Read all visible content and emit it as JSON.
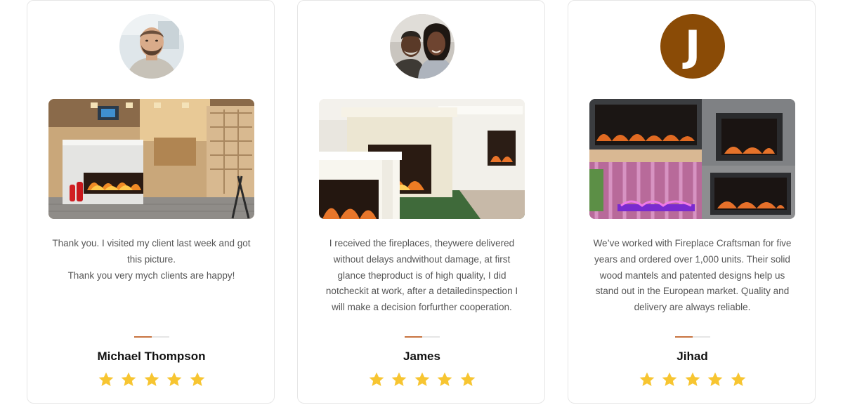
{
  "star_color": "#f7c531",
  "accent_color": "#c8733f",
  "testimonials": [
    {
      "avatar_icon": "man-portrait",
      "photo_icon": "restaurant-fireplace-photo",
      "review_lines": [
        "Thank you. I visited my client last week and got",
        "this picture.",
        "Thank you very mych clients are happy!"
      ],
      "name": "Michael Thompson",
      "rating": 5
    },
    {
      "avatar_icon": "couple-portrait",
      "photo_icon": "white-mantel-fireplaces-photo",
      "review_lines": [
        "I received the fireplaces, theywere delivered",
        "without delays andwithout damage, at first",
        "glance theproduct is of high quality, I did",
        "notcheckit at work, after a detailedinspection I",
        "will make a decision forfurther cooperation."
      ],
      "name": "James",
      "rating": 5
    },
    {
      "avatar_letter": "J",
      "avatar_color": "#8a4b06",
      "photo_icon": "electric-fireplace-showroom-photo",
      "review_lines": [
        "We’ve worked with Fireplace Craftsman for five",
        "years and ordered over 1,000 units. Their solid",
        "wood mantels and patented designs help us",
        "stand out in the European market. Quality and",
        "delivery are always reliable."
      ],
      "name": "Jihad",
      "rating": 5
    }
  ]
}
